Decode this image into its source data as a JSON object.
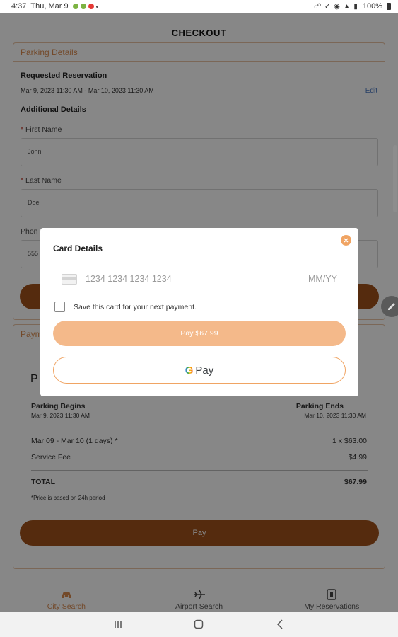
{
  "status_bar": {
    "time": "4:37",
    "date": "Thu, Mar 9",
    "battery": "100%"
  },
  "header": {
    "title": "CHECKOUT"
  },
  "parking_details": {
    "section_title": "Parking Details",
    "requested_label": "Requested Reservation",
    "requested_range": "Mar 9, 2023 11:30 AM - Mar 10, 2023 11:30 AM",
    "edit_label": "Edit",
    "additional_label": "Additional Details",
    "first_name_label": "First Name",
    "first_name_value": "John",
    "last_name_label": "Last Name",
    "last_name_value": "Doe",
    "phone_label": "Phon",
    "phone_value": "555",
    "required_marker": "*"
  },
  "payment": {
    "section_title": "Paym",
    "big_letter": "P",
    "begins_label": "Parking Begins",
    "begins_value": "Mar 9, 2023 11:30 AM",
    "ends_label": "Parking Ends",
    "ends_value": "Mar 10, 2023 11:30 AM",
    "line_item_label": "Mar 09 - Mar 10 (1 days) *",
    "line_item_value": "1 x $63.00",
    "service_fee_label": "Service Fee",
    "service_fee_value": "$4.99",
    "total_label": "TOTAL",
    "total_value": "$67.99",
    "note": "*Price is based on 24h period",
    "pay_label": "Pay"
  },
  "bottom_nav": {
    "items": [
      {
        "label": "City Search",
        "icon": "car-icon",
        "active": true
      },
      {
        "label": "Airport Search",
        "icon": "airplane-icon",
        "active": false
      },
      {
        "label": "My Reservations",
        "icon": "reservation-icon",
        "active": false
      }
    ]
  },
  "modal": {
    "title": "Card Details",
    "card_number_placeholder": "1234 1234 1234 1234",
    "expiry_placeholder": "MM/YY",
    "save_card_label": "Save this card for your next payment.",
    "save_card_checked": false,
    "pay_button_label": "Pay $67.99",
    "gpay_g": "G",
    "gpay_label": "Pay"
  },
  "colors": {
    "accent": "#d98a4e",
    "accent_dark": "#a0521c",
    "accent_light": "#f4b98a",
    "link": "#4a78c0"
  }
}
